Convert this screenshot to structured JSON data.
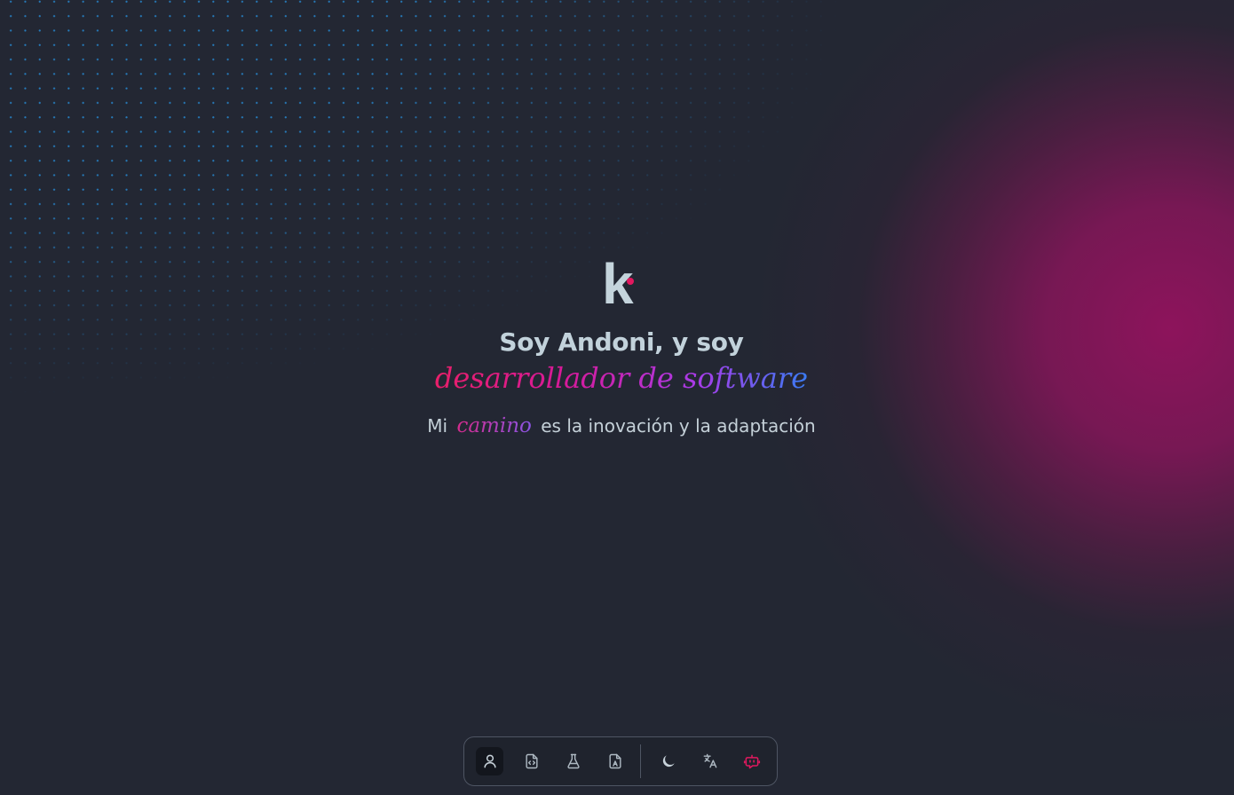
{
  "logo": {
    "letter": "k",
    "dot_color": "#e2185f"
  },
  "hero": {
    "headline": "Soy Andoni, y soy",
    "role": "desarrollador de software",
    "tagline_prefix": "Mi",
    "tagline_accent": "camino",
    "tagline_suffix": "es la inovación y la adaptación"
  },
  "colors": {
    "background": "#232733",
    "glow": "#8e1458",
    "dots": "#2896e6",
    "text": "#c2d2db",
    "accent_pink": "#e81f6a",
    "accent_blue": "#3a7bf5"
  },
  "dock": {
    "items": [
      {
        "icon": "user-icon",
        "active": true
      },
      {
        "icon": "code-file-icon",
        "active": false
      },
      {
        "icon": "flask-icon",
        "active": false
      },
      {
        "icon": "resume-file-icon",
        "active": false
      },
      {
        "icon": "moon-icon",
        "active": false
      },
      {
        "icon": "translate-icon",
        "active": false
      },
      {
        "icon": "chat-bot-icon",
        "active": false,
        "color": "#e2185f"
      }
    ]
  }
}
